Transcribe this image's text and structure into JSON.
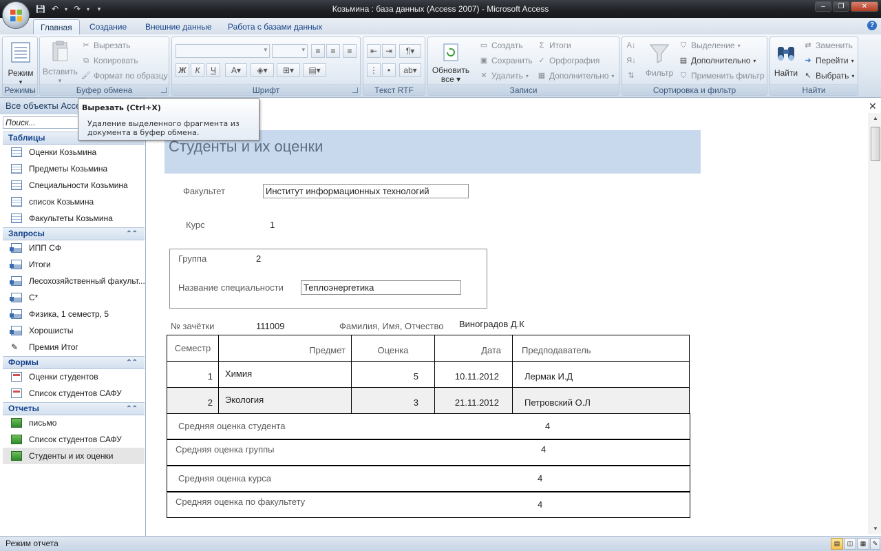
{
  "window": {
    "title": "Козьмина : база данных (Access 2007) - Microsoft Access"
  },
  "tabs": [
    "Главная",
    "Создание",
    "Внешние данные",
    "Работа с базами данных"
  ],
  "ribbon": {
    "groups": {
      "modes": "Режимы",
      "clipboard": "Буфер обмена",
      "font": "Шрифт",
      "rtf": "Текст RTF",
      "records": "Записи",
      "sortfilter": "Сортировка и фильтр",
      "find": "Найти"
    },
    "mode_btn": "Режим",
    "paste_btn": "Вставить",
    "cut": "Вырезать",
    "copy": "Копировать",
    "format_painter": "Формат по образцу",
    "refresh": "Обновить",
    "refresh2": "все",
    "create": "Создать",
    "save": "Сохранить",
    "delete": "Удалить",
    "totals": "Итоги",
    "spelling": "Орфография",
    "more": "Дополнительно",
    "filter": "Фильтр",
    "selection": "Выделение",
    "advanced": "Дополнительно",
    "apply_filter": "Применить фильтр",
    "find_btn": "Найти",
    "replace": "Заменить",
    "goto": "Перейти",
    "select": "Выбрать",
    "bold": "Ж",
    "italic": "К",
    "underline": "Ч"
  },
  "tooltip": {
    "title": "Вырезать (Ctrl+X)",
    "body": "Удаление выделенного фрагмента из документа в буфер обмена."
  },
  "nav": {
    "header": "Все объекты Acce",
    "search_placeholder": "Поиск...",
    "sections": {
      "tables": "Таблицы",
      "queries": "Запросы",
      "forms": "Формы",
      "reports": "Отчеты"
    },
    "tables": [
      "Оценки Козьмина",
      "Предметы Козьмина",
      "Специальности Козьмина",
      "список Козьмина",
      "Факультеты Козьмина"
    ],
    "queries": [
      "ИПП СФ",
      "Итоги",
      "Лесохозяйственный факульт...",
      "С*",
      "Физика, 1 семестр, 5",
      "Хорошисты",
      "Премия Итог"
    ],
    "forms": [
      "Оценки студентов",
      "Список студентов САФУ"
    ],
    "reports": [
      "письмо",
      "Список студентов САФУ",
      "Студенты и их оценки"
    ]
  },
  "report": {
    "title": "Студенты и их оценки",
    "faculty_label": "Факультет",
    "faculty_value": "Институт информационных технологий",
    "course_label": "Курс",
    "course_value": "1",
    "group_label": "Группа",
    "group_value": "2",
    "spec_label": "Название специальности",
    "spec_value": "Теплоэнергетика",
    "zach_label": "№ зачётки",
    "zach_value": "111009",
    "fio_label": "Фамилия, Имя, Отчество",
    "fio_value": "Виноградов Д.К",
    "columns": [
      "Семестр",
      "Предмет",
      "Оценка",
      "Дата",
      "Предподаватель"
    ],
    "rows": [
      [
        "1",
        "Химия",
        "5",
        "10.11.2012",
        "Лермак И.Д"
      ],
      [
        "2",
        "Экология",
        "3",
        "21.11.2012",
        "Петровский О.Л"
      ]
    ],
    "stats": [
      {
        "label": "Средняя оценка студента",
        "value": "4"
      },
      {
        "label": "Средняя оценка группы",
        "value": "4"
      },
      {
        "label": "Средняя оценка курса",
        "value": "4"
      },
      {
        "label": "Средняя оценка по факультету",
        "value": "4"
      }
    ]
  },
  "status": {
    "text": "Режим отчета"
  }
}
